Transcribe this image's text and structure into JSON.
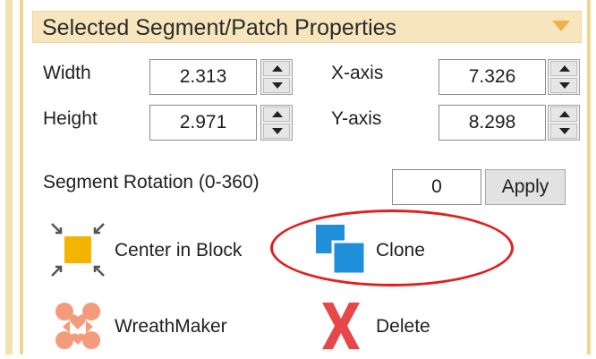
{
  "panel": {
    "title": "Selected Segment/Patch Properties"
  },
  "fields": {
    "width": {
      "label": "Width",
      "value": "2.313"
    },
    "height": {
      "label": "Height",
      "value": "2.971"
    },
    "x_axis": {
      "label": "X-axis",
      "value": "7.326"
    },
    "y_axis": {
      "label": "Y-axis",
      "value": "8.298"
    },
    "rotation": {
      "label": "Segment Rotation (0-360)",
      "value": "0"
    }
  },
  "buttons": {
    "apply": "Apply"
  },
  "actions": {
    "center_in_block": "Center in Block",
    "clone": "Clone",
    "wreathmaker": "WreathMaker",
    "delete": "Delete"
  },
  "colors": {
    "panel_border": "#f1d690",
    "header_bg": "#f7e6bd",
    "clone_blue": "#1e8fd8",
    "center_orange": "#f5b400",
    "wreath_salmon": "#f49b7c",
    "delete_red": "#e8474a",
    "highlight_red": "#e02020"
  },
  "icons": {
    "collapse": "triangle-down-icon",
    "center_in_block": "center-in-block-icon",
    "clone": "clone-icon",
    "wreathmaker": "wreathmaker-icon",
    "delete": "delete-x-icon",
    "spin_up": "arrow-up-icon",
    "spin_down": "arrow-down-icon"
  }
}
